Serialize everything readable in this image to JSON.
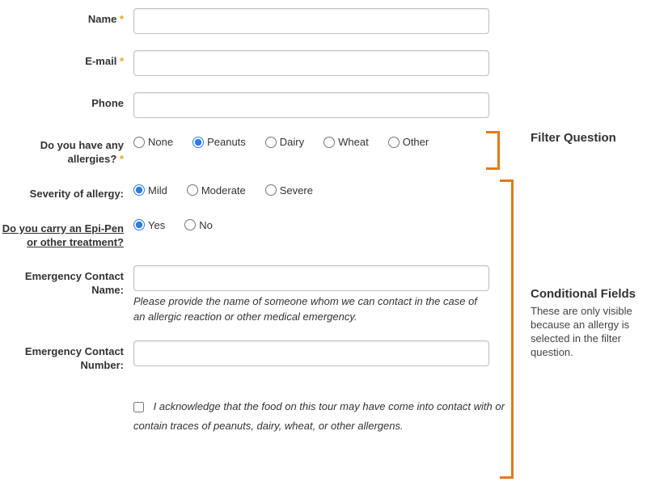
{
  "fields": {
    "name": {
      "label": "Name"
    },
    "email": {
      "label": "E-mail"
    },
    "phone": {
      "label": "Phone"
    },
    "allergies": {
      "label": "Do you have any allergies?",
      "options": [
        "None",
        "Peanuts",
        "Dairy",
        "Wheat",
        "Other"
      ],
      "selected": "Peanuts"
    },
    "severity": {
      "label": "Severity of allergy:",
      "options": [
        "Mild",
        "Moderate",
        "Severe"
      ],
      "selected": "Mild"
    },
    "epipen": {
      "label": "Do you carry an Epi-Pen or other treatment?",
      "options": [
        "Yes",
        "No"
      ],
      "selected": "Yes"
    },
    "emergency_name": {
      "label": "Emergency Contact Name:",
      "help": "Please provide the name of someone whom we can contact in the case of an allergic reaction or other medical emergency."
    },
    "emergency_number": {
      "label": "Emergency Contact Number:"
    },
    "acknowledge": {
      "text": "I acknowledge that the food on this tour may have come into contact with or contain traces of peanuts, dairy, wheat, or other allergens."
    }
  },
  "annotations": {
    "filter": {
      "title": "Filter Question"
    },
    "conditional": {
      "title": "Conditional Fields",
      "body": "These are only visible because an allergy is selected in the filter question."
    }
  }
}
